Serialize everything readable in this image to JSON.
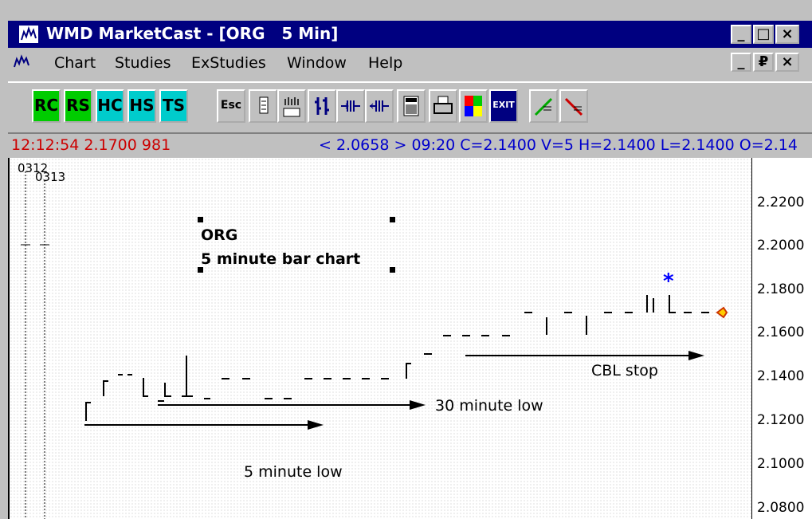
{
  "window": {
    "title": "WMD MarketCast - [ORG   5 Min]",
    "buttons": {
      "minimize": "_",
      "maximize": "□",
      "close": "×"
    }
  },
  "menu": {
    "items": [
      "Chart",
      "Studies",
      "ExStudies",
      "Window",
      "Help"
    ],
    "buttons": {
      "minimize": "_",
      "restore": "₽",
      "close": "×"
    }
  },
  "toolbar": {
    "buttons": [
      {
        "label": "RC",
        "color": "#00cc00"
      },
      {
        "label": "RS",
        "color": "#00cc00"
      },
      {
        "label": "HC",
        "color": "#00cccc"
      },
      {
        "label": "HS",
        "color": "#00cccc"
      },
      {
        "label": "TS",
        "color": "#00cccc"
      },
      {
        "label": "Esc",
        "color": "#c0c0c0"
      },
      {
        "label": "EXIT",
        "color": "#000080"
      }
    ]
  },
  "status": {
    "time_price_volume": "12:12:54  2.1700  981",
    "quote": "< 2.0658 > 09:20 C=2.1400 V=5  H=2.1400 L=2.1400 O=2.14",
    "left_color": "#cc0000",
    "quote_color": "#0000cc"
  },
  "chart": {
    "date_labels": [
      "0312",
      "0313"
    ],
    "y_axis_labels": [
      "2.2200",
      "2.2000",
      "2.1800",
      "2.1600",
      "2.1400",
      "2.1200",
      "2.1000",
      "2.0800"
    ],
    "annotation_title": "ORG",
    "annotation_subtitle": "5 minute bar chart",
    "arrow_labels": {
      "cbl": "CBL stop",
      "thirty_min": "30 minute low",
      "five_min": "5 minute low"
    },
    "star": "*"
  }
}
